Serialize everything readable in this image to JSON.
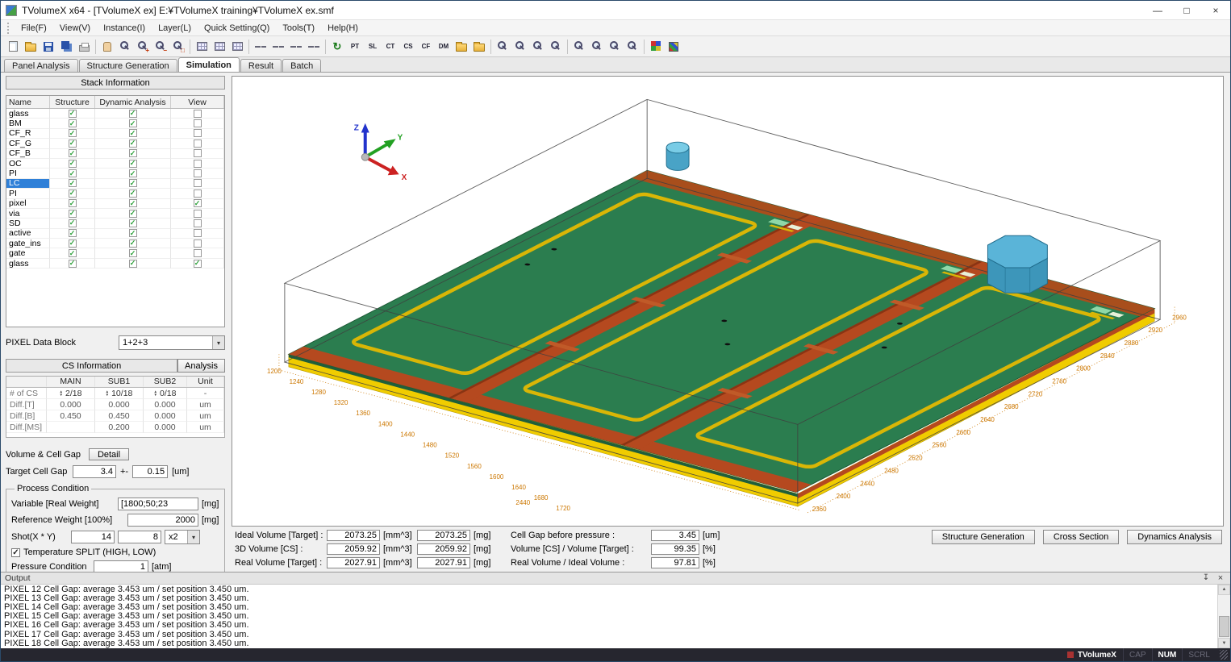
{
  "window": {
    "title": "TVolumeX x64 - [TVolumeX ex] E:¥TVolumeX training¥TVolumeX ex.smf",
    "controls": {
      "minimize": "—",
      "maximize": "□",
      "close": "×"
    }
  },
  "menu": {
    "items": [
      "File(F)",
      "View(V)",
      "Instance(I)",
      "Layer(L)",
      "Quick Setting(Q)",
      "Tools(T)",
      "Help(H)"
    ]
  },
  "toolbar": {
    "buttons": [
      {
        "name": "new-file",
        "kind": "doc"
      },
      {
        "name": "open-file",
        "kind": "folder"
      },
      {
        "name": "save-file",
        "kind": "save"
      },
      {
        "name": "save-all",
        "kind": "saveall"
      },
      {
        "name": "print",
        "kind": "printer"
      },
      {
        "sep": true
      },
      {
        "name": "pan-hand",
        "kind": "hand"
      },
      {
        "name": "zoom-window",
        "kind": "mag"
      },
      {
        "name": "zoom-in",
        "kind": "mag",
        "label": "+"
      },
      {
        "name": "zoom-out",
        "kind": "mag",
        "label": "−"
      },
      {
        "name": "zoom-fit",
        "kind": "mag",
        "label": "□"
      },
      {
        "sep": true
      },
      {
        "name": "grid-view",
        "kind": "grid"
      },
      {
        "name": "layer-table",
        "kind": "grid"
      },
      {
        "name": "pixel-matrix",
        "kind": "grid"
      },
      {
        "sep": true
      },
      {
        "name": "pair-display-1",
        "kind": "pair"
      },
      {
        "name": "pair-display-2",
        "kind": "pair"
      },
      {
        "name": "pair-display-3",
        "kind": "pair"
      },
      {
        "name": "pair-display-4",
        "kind": "pair"
      },
      {
        "sep": true
      },
      {
        "name": "refresh-structure",
        "kind": "refresh",
        "label": "↻"
      },
      {
        "name": "tool-pt",
        "kind": "txt",
        "label": "PT"
      },
      {
        "name": "tool-sl",
        "kind": "txt",
        "label": "SL"
      },
      {
        "name": "tool-ct",
        "kind": "txt",
        "label": "CT"
      },
      {
        "name": "tool-cs",
        "kind": "txt",
        "label": "CS"
      },
      {
        "name": "tool-cf",
        "kind": "txt",
        "label": "CF"
      },
      {
        "name": "tool-dm",
        "kind": "txt",
        "label": "DM"
      },
      {
        "name": "folder-export-1",
        "kind": "folder"
      },
      {
        "name": "folder-export-2",
        "kind": "folder"
      },
      {
        "sep": true
      },
      {
        "name": "zoom-region-1",
        "kind": "mag"
      },
      {
        "name": "zoom-region-2",
        "kind": "mag"
      },
      {
        "name": "zoom-region-3",
        "kind": "mag"
      },
      {
        "name": "zoom-region-4",
        "kind": "mag"
      },
      {
        "sep": true
      },
      {
        "name": "zoom-layer-1",
        "kind": "mag"
      },
      {
        "name": "zoom-layer-2",
        "kind": "mag"
      },
      {
        "name": "zoom-layer-3",
        "kind": "mag"
      },
      {
        "name": "zoom-layer-4",
        "kind": "mag"
      },
      {
        "sep": true
      },
      {
        "name": "palette",
        "kind": "palette"
      },
      {
        "name": "color-matrix",
        "kind": "colors"
      }
    ]
  },
  "tabs": {
    "items": [
      {
        "label": "Panel Analysis",
        "active": false
      },
      {
        "label": "Structure Generation",
        "active": false
      },
      {
        "label": "Simulation",
        "active": true
      },
      {
        "label": "Result",
        "active": false
      },
      {
        "label": "Batch",
        "active": false
      }
    ]
  },
  "stack": {
    "header": "Stack Information",
    "columns": [
      "Name",
      "Structure",
      "Dynamic Analysis",
      "View"
    ],
    "rows": [
      {
        "name": "glass",
        "structure": true,
        "dynamic": true,
        "view": false,
        "selected": false
      },
      {
        "name": "BM",
        "structure": true,
        "dynamic": true,
        "view": false,
        "selected": false
      },
      {
        "name": "CF_R",
        "structure": true,
        "dynamic": true,
        "view": false,
        "selected": false
      },
      {
        "name": "CF_G",
        "structure": true,
        "dynamic": true,
        "view": false,
        "selected": false
      },
      {
        "name": "CF_B",
        "structure": true,
        "dynamic": true,
        "view": false,
        "selected": false
      },
      {
        "name": "OC",
        "structure": true,
        "dynamic": true,
        "view": false,
        "selected": false
      },
      {
        "name": "PI",
        "structure": true,
        "dynamic": true,
        "view": false,
        "selected": false
      },
      {
        "name": "LC",
        "structure": true,
        "dynamic": true,
        "view": false,
        "selected": true
      },
      {
        "name": "PI",
        "structure": true,
        "dynamic": true,
        "view": false,
        "selected": false
      },
      {
        "name": "pixel",
        "structure": true,
        "dynamic": true,
        "view": true,
        "selected": false
      },
      {
        "name": "via",
        "structure": true,
        "dynamic": true,
        "view": false,
        "selected": false
      },
      {
        "name": "SD",
        "structure": true,
        "dynamic": true,
        "view": false,
        "selected": false
      },
      {
        "name": "active",
        "structure": true,
        "dynamic": true,
        "view": false,
        "selected": false
      },
      {
        "name": "gate_ins",
        "structure": true,
        "dynamic": true,
        "view": false,
        "selected": false
      },
      {
        "name": "gate",
        "structure": true,
        "dynamic": true,
        "view": false,
        "selected": false
      },
      {
        "name": "glass",
        "structure": true,
        "dynamic": true,
        "view": true,
        "selected": false
      }
    ]
  },
  "pixel_block": {
    "label": "PIXEL Data Block",
    "value": "1+2+3"
  },
  "cs": {
    "header": "CS Information",
    "analysis_button": "Analysis",
    "columns": [
      "",
      "MAIN",
      "SUB1",
      "SUB2",
      "Unit"
    ],
    "rows": [
      {
        "label": "# of CS",
        "main": "2/18",
        "sub1": "10/18",
        "sub2": "0/18",
        "unit": "-",
        "spinner": true
      },
      {
        "label": "Diff.[T]",
        "main": "0.000",
        "sub1": "0.000",
        "sub2": "0.000",
        "unit": "um",
        "spinner": false
      },
      {
        "label": "Diff.[B]",
        "main": "0.450",
        "sub1": "0.450",
        "sub2": "0.000",
        "unit": "um",
        "spinner": false
      },
      {
        "label": "Diff.[MS]",
        "main": "",
        "sub1": "0.200",
        "sub2": "0.000",
        "unit": "um",
        "spinner": false
      }
    ]
  },
  "volume_cell_gap": {
    "label": "Volume & Cell Gap",
    "detail_button": "Detail",
    "target_label": "Target Cell Gap",
    "target_value": "3.4",
    "pm": "+-",
    "tolerance": "0.15",
    "unit": "[um]"
  },
  "process": {
    "title": "Process Condition",
    "variable_label": "Variable [Real Weight]",
    "variable_value": "[1800;50;23",
    "variable_unit": "[mg]",
    "reference_label": "Reference Weight [100%]",
    "reference_value": "2000",
    "reference_unit": "[mg]",
    "shot_label": "Shot(X * Y)",
    "shot_x": "14",
    "shot_y": "8",
    "shot_mult": "x2",
    "temp_split_label": "Temperature SPLIT (HIGH, LOW)",
    "temp_split_checked": true,
    "pressure_label": "Pressure Condition",
    "pressure_value": "1",
    "pressure_unit": "[atm]"
  },
  "results": {
    "rows": [
      {
        "label": "Ideal Volume [Target] :",
        "v1": "2073.25",
        "u1": "[mm^3]",
        "v2": "2073.25",
        "u2": "[mg]",
        "label2": "Cell Gap before pressure :",
        "v3": "3.45",
        "u3": "[um]"
      },
      {
        "label": "3D Volume [CS] :",
        "v1": "2059.92",
        "u1": "[mm^3]",
        "v2": "2059.92",
        "u2": "[mg]",
        "label2": "Volume [CS] / Volume [Target] :",
        "v3": "99.35",
        "u3": "[%]"
      },
      {
        "label": "Real Volume [Target] :",
        "v1": "2027.91",
        "u1": "[mm^3]",
        "v2": "2027.91",
        "u2": "[mg]",
        "label2": "Real Volume / Ideal Volume :",
        "v3": "97.81",
        "u3": "[%]"
      }
    ],
    "buttons": [
      "Structure Generation",
      "Cross Section",
      "Dynamics Analysis"
    ]
  },
  "viewport": {
    "axis_labels": {
      "x": "X",
      "y": "Y",
      "z": "Z"
    },
    "dim_labels_left": [
      "1200",
      "1240",
      "1280",
      "1320",
      "1360",
      "1400",
      "1440",
      "1480",
      "1520",
      "1560",
      "1600",
      "1640",
      "1680",
      "1720"
    ],
    "dim_labels_right": [
      "2960",
      "2920",
      "2880",
      "2840",
      "2800",
      "2760",
      "2720",
      "2680",
      "2640",
      "2600",
      "2560",
      "2520",
      "2480",
      "2440",
      "2400",
      "2360"
    ],
    "extra_label": "2440"
  },
  "output": {
    "title": "Output",
    "lines": [
      "PIXEL 12 Cell Gap: average 3.453 um / set position 3.450 um.",
      "PIXEL 13 Cell Gap: average 3.453 um / set position 3.450 um.",
      "PIXEL 14 Cell Gap: average 3.453 um / set position 3.450 um.",
      "PIXEL 15 Cell Gap: average 3.453 um / set position 3.450 um.",
      "PIXEL 16 Cell Gap: average 3.453 um / set position 3.450 um.",
      "PIXEL 17 Cell Gap: average 3.453 um / set position 3.450 um.",
      "PIXEL 18 Cell Gap: average 3.453 um / set position 3.450 um."
    ]
  },
  "statusbar": {
    "app": "TVolumeX",
    "indicators": [
      {
        "label": "CAP",
        "on": false
      },
      {
        "label": "NUM",
        "on": true
      },
      {
        "label": "SCRL",
        "on": false
      }
    ]
  },
  "colors": {
    "selection": "#2f80d8",
    "check_green": "#2fa23c",
    "panel_green": "#2b7d4f",
    "stripe_orange": "#b5491f",
    "seal_gold": "#d9b606",
    "glass_yellow": "#f0cc00",
    "cylinder_cyan": "#5ab4d8",
    "dim_label_orange": "#cc7700"
  }
}
